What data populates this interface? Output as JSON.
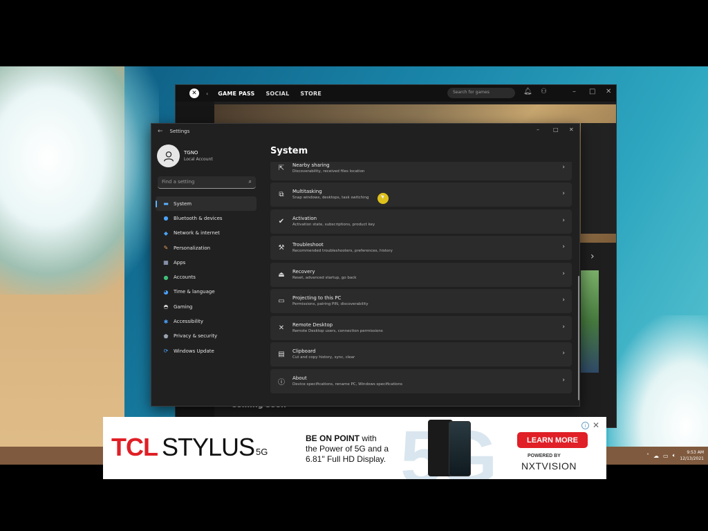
{
  "xbox": {
    "tabs": [
      {
        "label": "GAME PASS",
        "active": true
      },
      {
        "label": "SOCIAL",
        "active": false
      },
      {
        "label": "STORE",
        "active": false
      }
    ],
    "search_placeholder": "Search for games",
    "section_heading": "Coming soon"
  },
  "settings": {
    "window_title": "Settings",
    "user": {
      "name": "TGNO",
      "account_type": "Local Account"
    },
    "search_placeholder": "Find a setting",
    "nav": [
      {
        "label": "System",
        "icon": "monitor-icon",
        "selected": true
      },
      {
        "label": "Bluetooth & devices",
        "icon": "bluetooth-icon",
        "selected": false
      },
      {
        "label": "Network & internet",
        "icon": "wifi-icon",
        "selected": false
      },
      {
        "label": "Personalization",
        "icon": "brush-icon",
        "selected": false
      },
      {
        "label": "Apps",
        "icon": "apps-icon",
        "selected": false
      },
      {
        "label": "Accounts",
        "icon": "person-icon",
        "selected": false
      },
      {
        "label": "Time & language",
        "icon": "globe-clock-icon",
        "selected": false
      },
      {
        "label": "Gaming",
        "icon": "gamepad-icon",
        "selected": false
      },
      {
        "label": "Accessibility",
        "icon": "accessibility-icon",
        "selected": false
      },
      {
        "label": "Privacy & security",
        "icon": "shield-icon",
        "selected": false
      },
      {
        "label": "Windows Update",
        "icon": "update-icon",
        "selected": false
      }
    ],
    "page_title": "System",
    "rows": [
      {
        "title": "Nearby sharing",
        "subtitle": "Discoverability, received files location",
        "icon": "share-icon"
      },
      {
        "title": "Multitasking",
        "subtitle": "Snap windows, desktops, task switching",
        "icon": "multitask-icon"
      },
      {
        "title": "Activation",
        "subtitle": "Activation state, subscriptions, product key",
        "icon": "check-circle-icon"
      },
      {
        "title": "Troubleshoot",
        "subtitle": "Recommended troubleshooters, preferences, history",
        "icon": "wrench-icon"
      },
      {
        "title": "Recovery",
        "subtitle": "Reset, advanced startup, go back",
        "icon": "recovery-icon"
      },
      {
        "title": "Projecting to this PC",
        "subtitle": "Permissions, pairing PIN, discoverability",
        "icon": "project-icon"
      },
      {
        "title": "Remote Desktop",
        "subtitle": "Remote Desktop users, connection permissions",
        "icon": "remote-desktop-icon"
      },
      {
        "title": "Clipboard",
        "subtitle": "Cut and copy history, sync, clear",
        "icon": "clipboard-icon"
      },
      {
        "title": "About",
        "subtitle": "Device specifications, rename PC, Windows specifications",
        "icon": "info-icon"
      }
    ]
  },
  "taskbar": {
    "time": "9:53 AM",
    "date": "12/13/2021"
  },
  "ad": {
    "brand": "TCL",
    "product": "STYLUS",
    "product_suffix": "5G",
    "headline": "BE ON POINT",
    "headline_rest": " with",
    "line2": "the Power of 5G and a",
    "line3": "6.81\" Full HD Display.",
    "cta": "LEARN MORE",
    "powered_by": "POWERED BY",
    "partner": "NXTVISION",
    "big_text": "5G"
  },
  "colors": {
    "accent": "#5cb3ff",
    "ad_red": "#e01f26",
    "cursor_highlight": "#f2d21a"
  }
}
